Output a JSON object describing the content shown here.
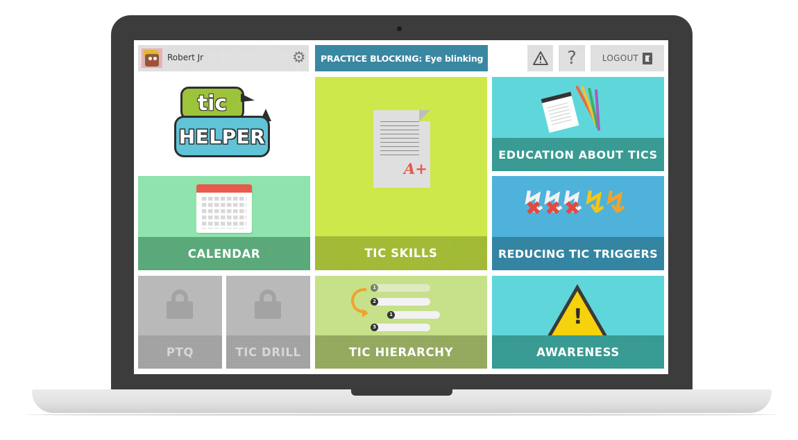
{
  "user": {
    "name": "Robert Jr"
  },
  "header": {
    "practice_label": "PRACTICE BLOCKING: Eye blinking",
    "help_symbol": "?",
    "logout_label": "LOGOUT"
  },
  "logo": {
    "top_text": "tic",
    "bottom_text": "HELPER"
  },
  "tiles": {
    "calendar": "CALENDAR",
    "tic_skills": "TIC SKILLS",
    "grade": "A+",
    "education": "EDUCATION ABOUT TICS",
    "reducing": "REDUCING TIC TRIGGERS",
    "ptq": "PTQ",
    "tic_drill": "TIC DRILL",
    "hierarchy": "TIC HIERARCHY",
    "awareness": "AWARENESS"
  },
  "hierarchy_numbers": [
    "1",
    "2",
    "1",
    "3"
  ],
  "colors": {
    "practice_bar": "#3a87a1",
    "calendar": "#8fe3ad",
    "tic_skills": "#cde84a",
    "education": "#5fd6da",
    "reducing": "#4fb2da",
    "locked": "#b9b9b9",
    "hierarchy": "#c7e08a",
    "awareness": "#5fd6da"
  },
  "icons": {
    "settings": "gear-icon",
    "alert": "warning-icon",
    "help": "question-icon",
    "logout": "door-exit-icon",
    "locked": "lock-icon"
  }
}
